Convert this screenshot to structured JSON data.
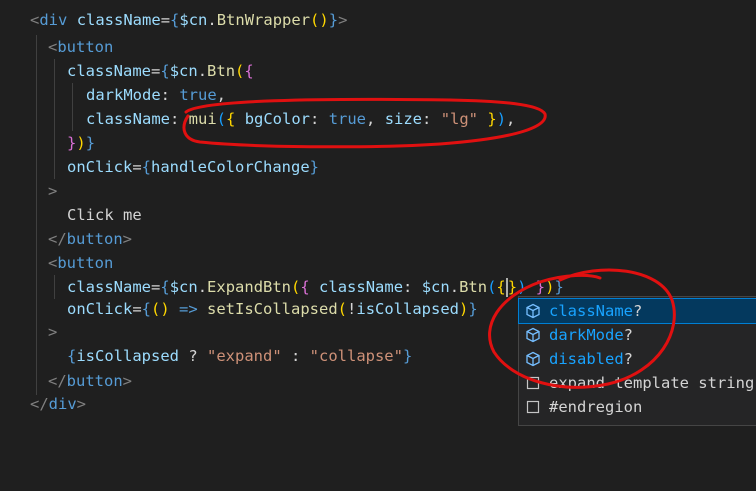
{
  "code": {
    "l1": {
      "open": "<",
      "tag": "div",
      "attr": "className",
      "eq": "=",
      "b1": "{",
      "obj": "$cn",
      "dot": ".",
      "fn": "BtnWrapper",
      "paren": "()",
      "b2": "}",
      "close": ">"
    },
    "l2": {
      "open": "<",
      "tag": "button"
    },
    "l3": {
      "attr": "className",
      "eq": "=",
      "b1": "{",
      "obj": "$cn",
      "dot": ".",
      "fn": "Btn",
      "p1": "(",
      "b2": "{"
    },
    "l4": {
      "key": "darkMode",
      "colon": ": ",
      "val": "true",
      "comma": ","
    },
    "l5": {
      "key": "className",
      "colon": ": ",
      "fn": "mui",
      "p1": "(",
      "b1": "{ ",
      "k1": "bgColor",
      "c1": ": ",
      "v1": "true",
      "cm1": ", ",
      "k2": "size",
      "c2": ": ",
      "v2": "\"lg\"",
      "b2": " }",
      "p2": ")",
      "comma": ","
    },
    "l6": {
      "b2": "}",
      "p1": ")",
      "b1": "}"
    },
    "l7": {
      "attr": "onClick",
      "eq": "=",
      "b1": "{",
      "id": "handleColorChange",
      "b2": "}"
    },
    "l8": {
      "close": ">"
    },
    "l9": {
      "text": "Click me"
    },
    "l10": {
      "open": "</",
      "tag": "button",
      "close": ">"
    },
    "l11": {
      "open": "<",
      "tag": "button"
    },
    "l12": {
      "attr": "className",
      "eq": "=",
      "b1": "{",
      "obj": "$cn",
      "dot": ".",
      "fn": "ExpandBtn",
      "p1": "(",
      "b2": "{ ",
      "key": "className",
      "colon": ": ",
      "obj2": "$cn",
      "dot2": ".",
      "fn2": "Btn",
      "p2": "(",
      "b3": "{",
      "b4": "}",
      "p3": ")",
      "b5": " }",
      "p4": ")",
      "b6": "}"
    },
    "l13": {
      "attr": "onClick",
      "eq": "=",
      "b1": "{",
      "p1": "()",
      "arrow": " => ",
      "fn": "setIsCollapsed",
      "p2": "(",
      "bang": "!",
      "id": "isCollapsed",
      "p3": ")",
      "b2": "}"
    },
    "l14": {
      "close": ">"
    },
    "l15": {
      "b1": "{",
      "id": "isCollapsed",
      "q": " ? ",
      "s1": "\"expand\"",
      "c": " : ",
      "s2": "\"collapse\"",
      "b2": "}"
    },
    "l16": {
      "open": "</",
      "tag": "button",
      "close": ">"
    },
    "l17": {
      "open": "</",
      "tag": "div",
      "close": ">"
    }
  },
  "suggestions": [
    {
      "match": "className",
      "rest": "?",
      "icon": "cube-icon",
      "selected": true
    },
    {
      "match": "darkMode",
      "rest": "?",
      "icon": "cube-icon",
      "selected": false
    },
    {
      "match": "disabled",
      "rest": "?",
      "icon": "cube-icon",
      "selected": false
    },
    {
      "match": "",
      "rest": "expand template string",
      "icon": "snippet-icon",
      "selected": false
    },
    {
      "match": "",
      "rest": "#endregion",
      "icon": "snippet-icon",
      "selected": false
    }
  ],
  "colors": {
    "annotation": "#e01010",
    "selected_bg": "#04395e",
    "match_text": "#18a3ff"
  }
}
